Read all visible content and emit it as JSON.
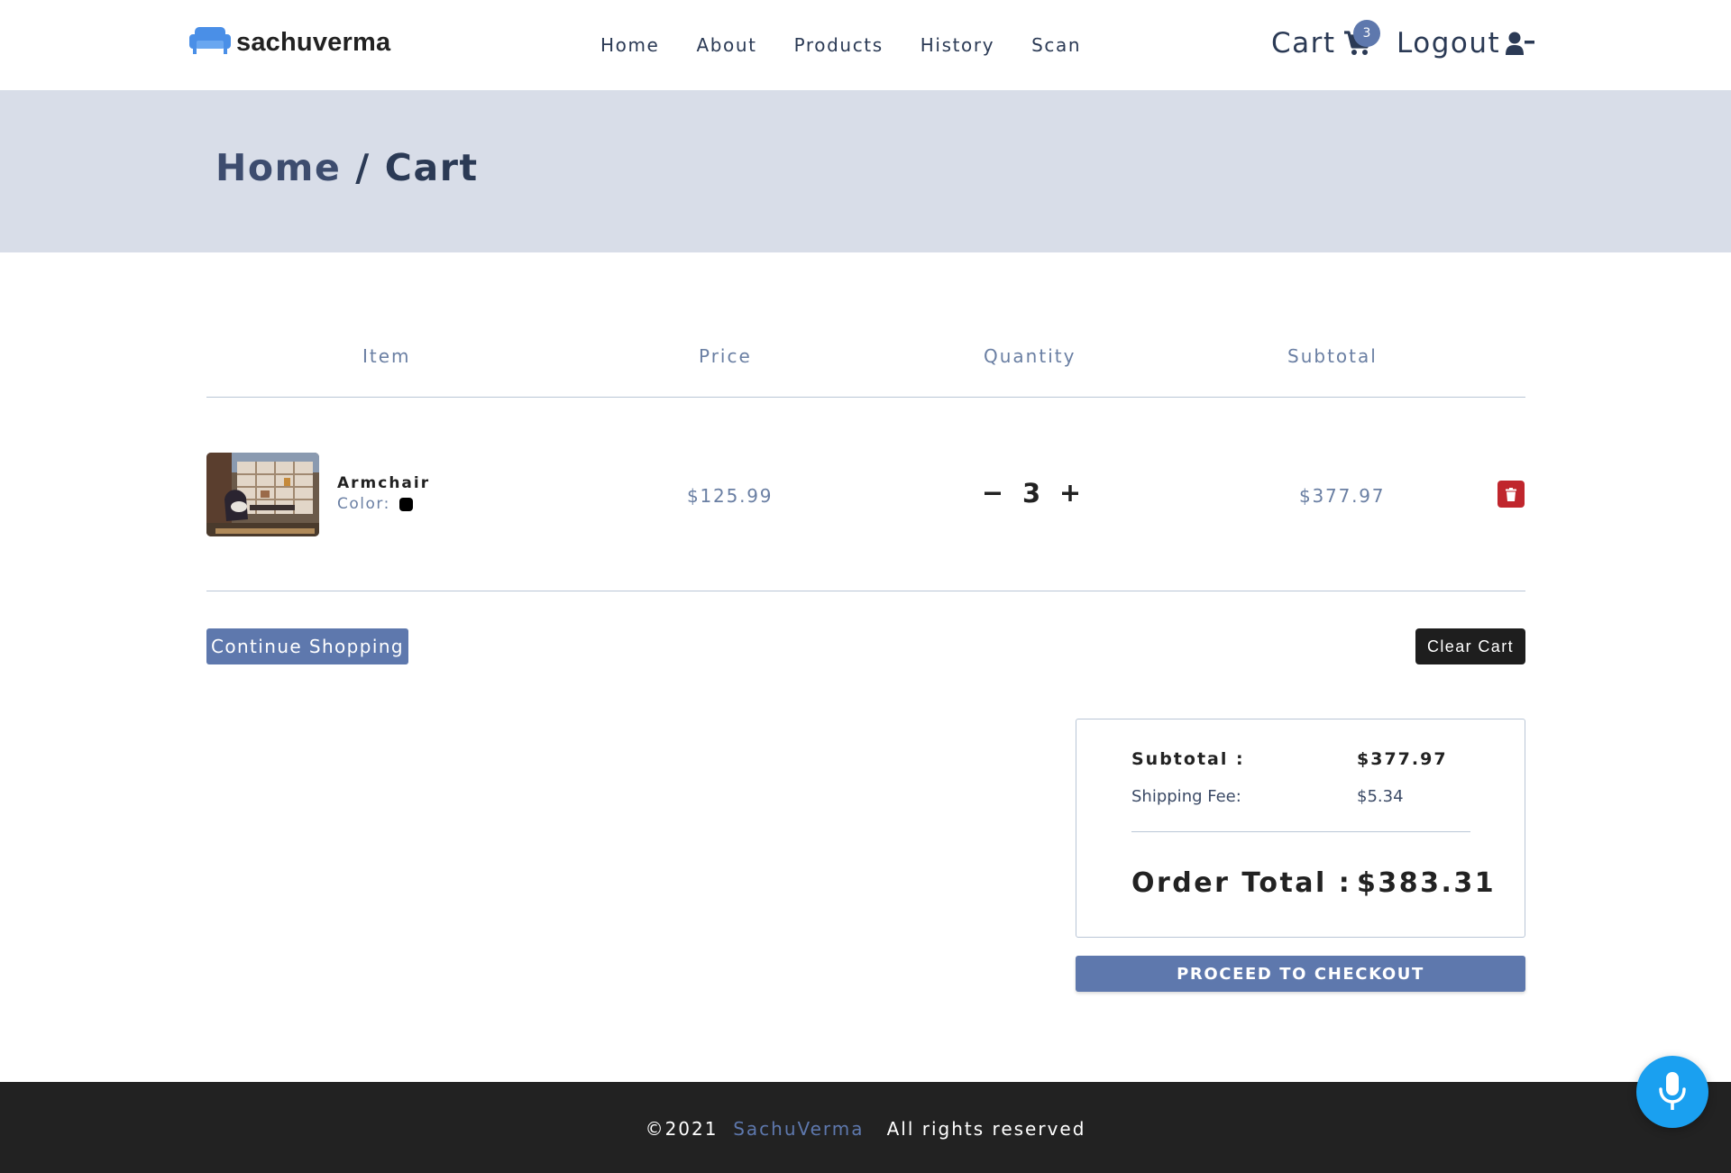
{
  "header": {
    "brand": "sachuverma",
    "nav": [
      "Home",
      "About",
      "Products",
      "History",
      "Scan"
    ],
    "cart_label": "Cart",
    "cart_count": "3",
    "logout_label": "Logout"
  },
  "breadcrumb": {
    "home": "Home",
    "separator": "/",
    "current": "Cart"
  },
  "table": {
    "columns": [
      "Item",
      "Price",
      "Quantity",
      "Subtotal"
    ],
    "rows": [
      {
        "name": "Armchair",
        "color_label": "Color:",
        "color": "#000000",
        "price": "$125.99",
        "quantity": "3",
        "subtotal": "$377.97"
      }
    ]
  },
  "actions": {
    "continue_label": "Continue Shopping",
    "clear_label": "Clear Cart",
    "checkout_label": "PROCEED TO CHECKOUT"
  },
  "totals": {
    "subtotal_label": "Subtotal :",
    "subtotal_value": "$377.97",
    "shipping_label": "Shipping Fee:",
    "shipping_value": "$5.34",
    "order_total_label": "Order Total :",
    "order_total_value": "$383.31"
  },
  "footer": {
    "copyright": "©2021",
    "brand": "SachuVerma",
    "rights": "All rights reserved"
  },
  "colors": {
    "accent": "#5e78ad",
    "band": "#d8dde8",
    "danger": "#c0262d",
    "footer": "#222222",
    "mic": "#1aa0f0"
  },
  "icons": [
    "sofa-logo-icon",
    "cart-icon",
    "user-minus-icon",
    "trash-icon",
    "microphone-icon"
  ]
}
